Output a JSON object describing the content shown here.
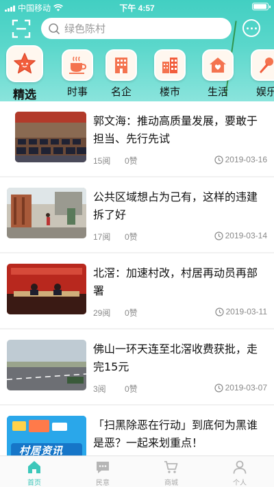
{
  "status_bar": {
    "carrier": "中国移动",
    "time": "下午 4:57"
  },
  "search": {
    "placeholder": "绿色陈村"
  },
  "categories": [
    {
      "label": "精选",
      "icon": "star-icon",
      "active": true
    },
    {
      "label": "时事",
      "icon": "coffee-cup-icon"
    },
    {
      "label": "名企",
      "icon": "office-building-icon"
    },
    {
      "label": "楼市",
      "icon": "apartment-buildings-icon"
    },
    {
      "label": "生活",
      "icon": "house-heart-icon"
    },
    {
      "label": "娱乐",
      "icon": "microphone-icon"
    }
  ],
  "news": [
    {
      "title": "郭文海：推动高质量发展，要敢于担当、先行先试",
      "reads": "15阅",
      "likes": "0赞",
      "date": "2019-03-16",
      "thumb": "conference-meeting-photo"
    },
    {
      "title": "公共区域想占为己有，这样的违建拆了好",
      "reads": "17阅",
      "likes": "0赞",
      "date": "2019-03-14",
      "thumb": "street-demolition-photo"
    },
    {
      "title": "北滘：加速村改，村居再动员再部署",
      "reads": "29阅",
      "likes": "0赞",
      "date": "2019-03-11",
      "thumb": "stage-meeting-photo"
    },
    {
      "title": "佛山一环天连至北滘收费获批，走完15元",
      "reads": "3阅",
      "likes": "0赞",
      "date": "2019-03-07",
      "thumb": "highway-photo"
    },
    {
      "title": "「扫黑除恶在行动」到底何为黑谁是恶？一起来划重点！",
      "reads": "",
      "likes": "",
      "date": "",
      "thumb": "village-news-banner",
      "thumb_text": "村居资讯"
    }
  ],
  "tabs": [
    {
      "label": "首页",
      "icon": "home-icon",
      "active": true
    },
    {
      "label": "民意",
      "icon": "chat-bubble-icon"
    },
    {
      "label": "商城",
      "icon": "shopping-cart-icon"
    },
    {
      "label": "个人",
      "icon": "person-icon"
    }
  ],
  "colors": {
    "accent": "#3cc7ba",
    "header_top": "#42cfc2",
    "muted_text": "#888888"
  }
}
